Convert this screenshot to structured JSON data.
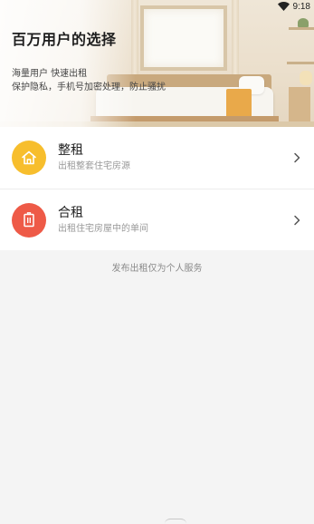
{
  "status_bar": {
    "time": "9:18",
    "wifi_icon": "wifi-icon"
  },
  "hero": {
    "title": "百万用户的选择",
    "subtitle_line1": "海量用户 快速出租",
    "subtitle_line2": "保护隐私，手机号加密处理，防止骚扰"
  },
  "menu": {
    "items": [
      {
        "title": "整租",
        "description": "出租整套住宅房源",
        "icon": "house-icon",
        "icon_color": "#f7be2d"
      },
      {
        "title": "合租",
        "description": "出租住宅房屋中的单间",
        "icon": "room-door-icon",
        "icon_color": "#ee5a47"
      }
    ]
  },
  "footer": {
    "note": "发布出租仅为个人服务"
  }
}
